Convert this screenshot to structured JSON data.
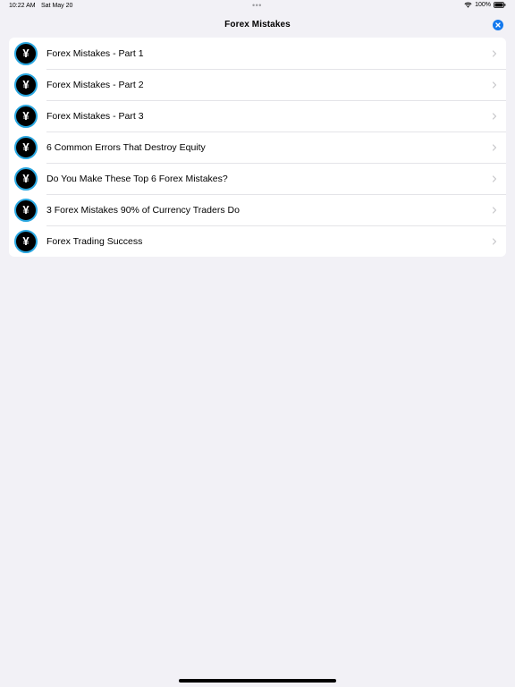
{
  "status_bar": {
    "time": "10:22 AM",
    "date": "Sat May 20",
    "dots": "•••",
    "battery": "100%"
  },
  "nav": {
    "title": "Forex Mistakes",
    "close_icon": "close-icon"
  },
  "list": {
    "icon": "yen-icon",
    "icon_glyph": "¥",
    "items": [
      {
        "label": "Forex Mistakes - Part 1"
      },
      {
        "label": "Forex Mistakes - Part 2"
      },
      {
        "label": "Forex Mistakes - Part 3"
      },
      {
        "label": "6 Common Errors That Destroy Equity"
      },
      {
        "label": "Do You Make These Top 6 Forex Mistakes?"
      },
      {
        "label": "3 Forex Mistakes 90% of Currency Traders Do"
      },
      {
        "label": "Forex Trading Success"
      }
    ]
  },
  "colors": {
    "background": "#f2f1f6",
    "accent": "#1479ee",
    "icon_ring": "#2aa7e0"
  }
}
